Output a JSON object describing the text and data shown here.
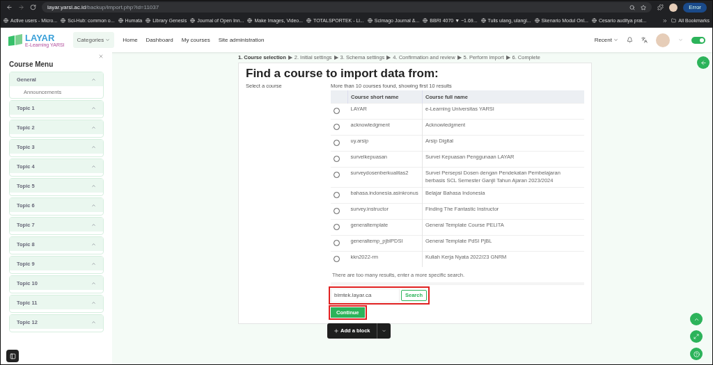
{
  "browser": {
    "url_host": "layar.yarsi.ac.id",
    "url_path": "/backup/import.php?id=11037",
    "profile_button": "Error",
    "bookmarks": [
      "Active users - Micro...",
      "Sci-Hub: common o...",
      "Humata",
      "Library Genesis",
      "Journal of Open Inn...",
      "Make Images, Video...",
      "TOTALSPORTEK - Li...",
      "Scimago Journal &...",
      "BBRI 4070 ▼ −1.69...",
      "Tulis ulang, ulangi...",
      "Skenario Modul Onl...",
      "Cesario auditya prat..."
    ],
    "all_bookmarks": "All Bookmarks"
  },
  "navbar": {
    "logo": "LAYAR",
    "logo_sub": "E-Learning YARSI",
    "items": [
      {
        "label": "Categories",
        "kind": "dropdown"
      },
      {
        "label": "Home",
        "kind": "link"
      },
      {
        "label": "Dashboard",
        "kind": "link"
      },
      {
        "label": "My courses",
        "kind": "link"
      },
      {
        "label": "Site administration",
        "kind": "link"
      }
    ],
    "recent": "Recent",
    "edit_mode_on": true
  },
  "sidebar": {
    "title": "Course Menu",
    "sections": [
      {
        "label": "General",
        "expanded": true,
        "children": [
          {
            "label": "Announcements"
          }
        ]
      },
      {
        "label": "Topic 1",
        "expanded": true
      },
      {
        "label": "Topic 2",
        "expanded": true
      },
      {
        "label": "Topic 3",
        "expanded": true
      },
      {
        "label": "Topic 4",
        "expanded": true
      },
      {
        "label": "Topic 5",
        "expanded": true
      },
      {
        "label": "Topic 6",
        "expanded": true
      },
      {
        "label": "Topic 7",
        "expanded": true
      },
      {
        "label": "Topic 8",
        "expanded": true
      },
      {
        "label": "Topic 9",
        "expanded": true
      },
      {
        "label": "Topic 10",
        "expanded": true
      },
      {
        "label": "Topic 11",
        "expanded": true
      },
      {
        "label": "Topic 12",
        "expanded": true
      }
    ]
  },
  "steps": [
    {
      "label": "1. Course selection",
      "selected": true
    },
    {
      "label": "2. Initial settings",
      "selected": false
    },
    {
      "label": "3. Schema settings",
      "selected": false
    },
    {
      "label": "4. Confirmation and review",
      "selected": false
    },
    {
      "label": "5. Perform import",
      "selected": false
    },
    {
      "label": "6. Complete",
      "selected": false
    }
  ],
  "step_separator": "▶",
  "heading": "Find a course to import data from:",
  "select_label": "Select a course",
  "results_note": "More than 10 courses found, showing first 10 results",
  "table": {
    "columns": [
      "Course short name",
      "Course full name"
    ],
    "rows": [
      {
        "short": "LAYAR",
        "full": "e-Learning Universitas YARSI",
        "selected": false
      },
      {
        "short": "acknowledgment",
        "full": "Acknowledgment",
        "selected": false
      },
      {
        "short": "uy.arsip",
        "full": "Arsip Digital",
        "selected": false
      },
      {
        "short": "survelkepuasan",
        "full": "Survei Kepuasan Penggunaan LAYAR",
        "selected": false
      },
      {
        "short": "surveydosenberkualitas2",
        "full": "Survei Persepsi Dosen dengan Pendekatan Pembelajaran berbasis SCL Semester Ganjil Tahun Ajaran 2023/2024",
        "selected": false
      },
      {
        "short": "bahasa.indonesia.asinkronus",
        "full": "Belajar Bahasa Indonesia",
        "selected": false
      },
      {
        "short": "survey.instructor",
        "full": "Finding The Fantastic Instructor",
        "selected": false
      },
      {
        "short": "generaltemplate",
        "full": "General Template Course PELITA",
        "selected": false
      },
      {
        "short": "generaltemp_pjblPDSI",
        "full": "General Template PdSI PjBL",
        "selected": false
      },
      {
        "short": "kkn2022-rm",
        "full": "Kuliah Kerja Nyata 2022/23 GNRM",
        "selected": false
      }
    ]
  },
  "too_many": "There are too many results, enter a more specific search.",
  "search": {
    "value": "bimtek.layar.ca",
    "button": "Search"
  },
  "continue": "Continue",
  "add_block": "Add a block"
}
